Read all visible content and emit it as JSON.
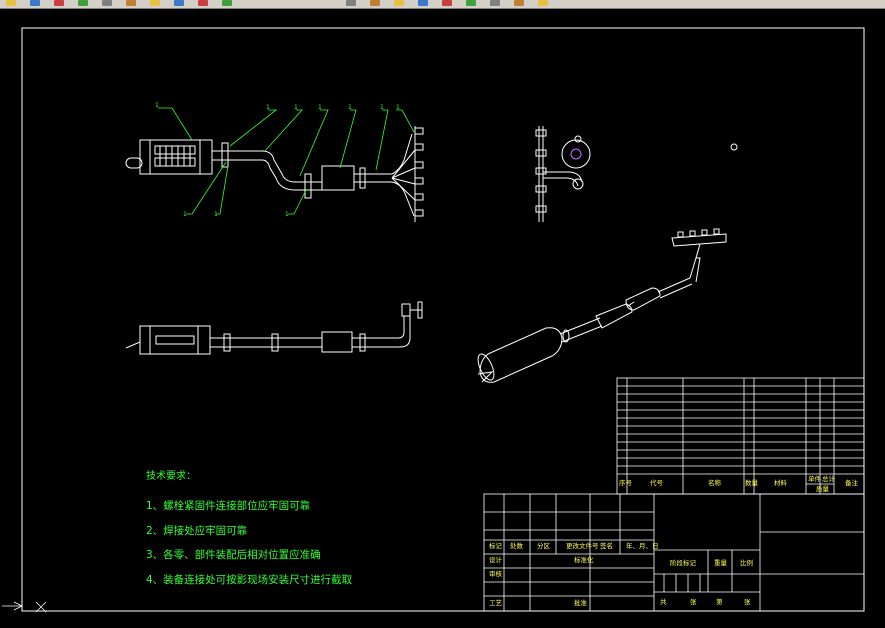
{
  "toolbar": {
    "icons": [
      "new-icon",
      "open-icon",
      "save-icon",
      "print-icon",
      "cut-icon",
      "copy-icon",
      "paste-icon",
      "match-icon",
      "undo-icon",
      "redo-icon",
      "pan-icon",
      "zoom-icon",
      "zoom-window-icon",
      "zoom-previous-icon",
      "properties-icon",
      "design-center-icon",
      "tool-palette-icon",
      "calculator-icon",
      "help-icon"
    ]
  },
  "colors": {
    "background": "#000000",
    "lines": "#ffffff",
    "leaders": "#33ff33",
    "text_yellow": "#ffff55",
    "text_green": "#33ff33"
  },
  "balloons": {
    "top_row": [
      "1",
      "1",
      "1",
      "1",
      "1",
      "1",
      "1"
    ],
    "bottom_row": [
      "1",
      "1",
      "1"
    ]
  },
  "tech_requirements": {
    "title": "技术要求：",
    "items": [
      "1、螺栓紧固件连接部位应牢固可靠",
      "2、焊接处应牢固可靠",
      "3、各零、部件装配后相对位置应准确",
      "4、装备连接处可按影现场安装尺寸进行截取"
    ]
  },
  "bom_header": [
    "序号",
    "代号",
    "名称",
    "数量",
    "材料",
    "单件",
    "总计",
    "质量",
    "备注"
  ],
  "title_block": {
    "row1": [
      "标记",
      "处数",
      "分区",
      "更改文件号",
      "签名",
      "年、月、日"
    ],
    "row2": [
      "设计",
      "",
      "标准化"
    ],
    "row3": [
      "审核"
    ],
    "row4": [
      "工艺",
      "",
      "批准"
    ],
    "stage_row": [
      "阶段标记",
      "重量",
      "比例"
    ],
    "sheet_row": [
      "共",
      "张",
      "第",
      "张"
    ]
  }
}
